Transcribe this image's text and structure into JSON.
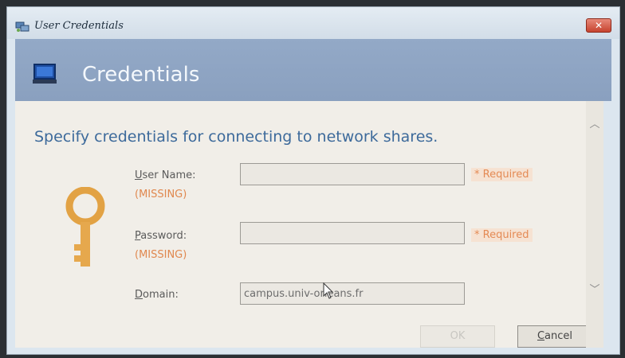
{
  "window": {
    "title": "User Credentials",
    "close_icon": "close-icon"
  },
  "banner": {
    "title": "Credentials",
    "icon": "computer-icon"
  },
  "main": {
    "heading": "Specify credentials for connecting to network shares.",
    "key_icon": "key-icon",
    "username": {
      "label_access": "U",
      "label_rest": "ser Name:",
      "missing": "(MISSING)",
      "value": "",
      "required": "* Required"
    },
    "password": {
      "label_access": "P",
      "label_rest": "assword:",
      "missing": "(MISSING)",
      "value": "",
      "required": "* Required"
    },
    "domain": {
      "label_access": "D",
      "label_rest": "omain:",
      "value": "campus.univ-orleans.fr"
    }
  },
  "buttons": {
    "ok": "OK",
    "cancel_access": "C",
    "cancel_rest": "ancel"
  },
  "colors": {
    "heading": "#3d6a9b",
    "banner": "#8aa0bf",
    "missing": "#e0884f",
    "required": "#e48a54"
  }
}
